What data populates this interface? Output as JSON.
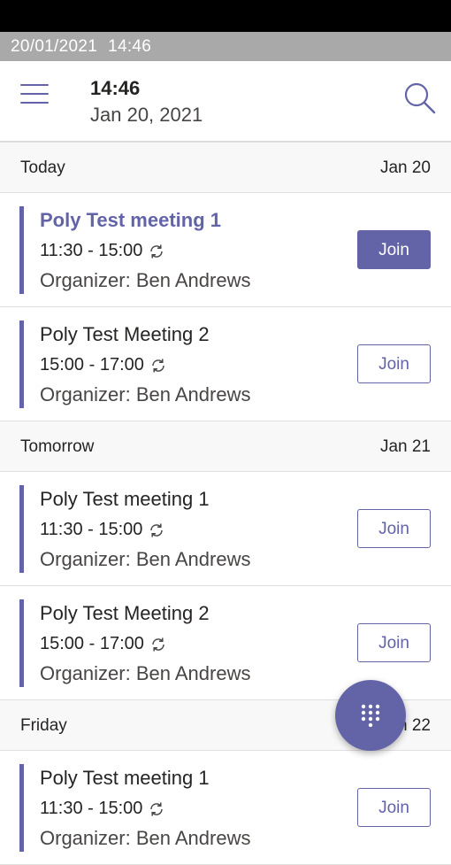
{
  "status_bar": {
    "date": "20/01/2021",
    "time": "14:46"
  },
  "header": {
    "time": "14:46",
    "date": "Jan 20, 2021",
    "menu_icon": "hamburger-menu-icon",
    "search_icon": "search-icon"
  },
  "days": [
    {
      "label": "Today",
      "date": "Jan 20",
      "meetings": [
        {
          "title": "Poly Test meeting 1",
          "time": "11:30 - 15:00",
          "organizer": "Organizer: Ben Andrews",
          "join_label": "Join"
        },
        {
          "title": "Poly Test Meeting 2",
          "time": "15:00 - 17:00",
          "organizer": "Organizer: Ben Andrews",
          "join_label": "Join"
        }
      ]
    },
    {
      "label": "Tomorrow",
      "date": "Jan 21",
      "meetings": [
        {
          "title": "Poly Test meeting 1",
          "time": "11:30 - 15:00",
          "organizer": "Organizer: Ben Andrews",
          "join_label": "Join"
        },
        {
          "title": "Poly Test Meeting 2",
          "time": "15:00 - 17:00",
          "organizer": "Organizer: Ben Andrews",
          "join_label": "Join"
        }
      ]
    },
    {
      "label": "Friday",
      "date": "Jan 22",
      "meetings": [
        {
          "title": "Poly Test meeting 1",
          "time": "11:30 - 15:00",
          "organizer": "Organizer: Ben Andrews",
          "join_label": "Join"
        }
      ]
    }
  ],
  "fab": {
    "icon": "dialpad-icon"
  },
  "colors": {
    "accent": "#6264a7",
    "status_bar_bg": "#a9a9a9"
  }
}
